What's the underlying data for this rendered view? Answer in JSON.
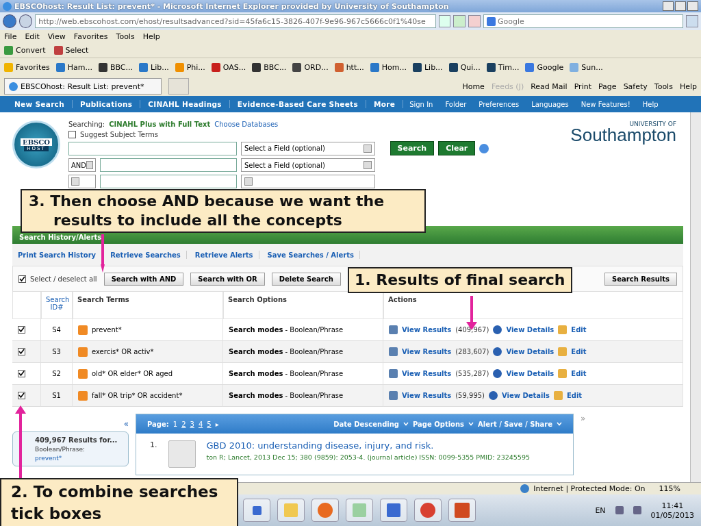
{
  "window": {
    "title": "EBSCOhost: Result List: prevent* - Microsoft Internet Explorer provided by University of Southampton"
  },
  "address_bar": {
    "url": "http://web.ebscohost.com/ehost/resultsadvanced?sid=45fa6c15-3826-407f-9e96-967c5666c0f1%40se",
    "search_placeholder": "Google"
  },
  "menu": [
    "File",
    "Edit",
    "View",
    "Favorites",
    "Tools",
    "Help"
  ],
  "toolbar": [
    "Convert",
    "Select"
  ],
  "favorites": [
    {
      "label": "Favorites",
      "color": "#f0b400"
    },
    {
      "label": "Ham...",
      "color": "#2a78c8"
    },
    {
      "label": "BBC...",
      "color": "#333333"
    },
    {
      "label": "Lib...",
      "color": "#2a78c8"
    },
    {
      "label": "Phi...",
      "color": "#f09000"
    },
    {
      "label": "OAS...",
      "color": "#c8201c"
    },
    {
      "label": "BBC...",
      "color": "#333333"
    },
    {
      "label": "ORD...",
      "color": "#444444"
    },
    {
      "label": "htt...",
      "color": "#d06030"
    },
    {
      "label": "Hom...",
      "color": "#2a78c8"
    },
    {
      "label": "Lib...",
      "color": "#1a4060"
    },
    {
      "label": "Qui...",
      "color": "#1a4060"
    },
    {
      "label": "Tim...",
      "color": "#1a4060"
    },
    {
      "label": "Google",
      "color": "#3a78e0"
    },
    {
      "label": "Sun...",
      "color": "#80b0e0"
    }
  ],
  "tab": {
    "title": "EBSCOhost: Result List: prevent*"
  },
  "command_bar": [
    {
      "label": "Home",
      "disabled": false
    },
    {
      "label": "Feeds (J)",
      "disabled": true
    },
    {
      "label": "Read Mail",
      "disabled": false
    },
    {
      "label": "Print",
      "disabled": false
    },
    {
      "label": "Page",
      "disabled": false
    },
    {
      "label": "Safety",
      "disabled": false
    },
    {
      "label": "Tools",
      "disabled": false
    },
    {
      "label": "Help",
      "disabled": false
    }
  ],
  "site_nav": {
    "main": [
      "New Search",
      "Publications",
      "CINAHL Headings",
      "Evidence-Based Care Sheets",
      "More"
    ],
    "right": [
      "Sign In",
      "Folder",
      "Preferences",
      "Languages",
      "New Features!",
      "Help"
    ]
  },
  "search": {
    "logo": "EBSCO",
    "logo_sub": "HOST",
    "searching_label": "Searching:",
    "database": "CINAHL Plus with Full Text",
    "choose_link": "Choose Databases",
    "suggest": {
      "label": "Suggest Subject Terms",
      "checked": false
    },
    "rows": [
      {
        "operator": null,
        "field": "Select a Field (optional)"
      },
      {
        "operator": "AND",
        "field": "Select a Field (optional)"
      }
    ],
    "buttons": [
      "Search",
      "Clear"
    ],
    "university_small": "UNIVERSITY OF",
    "university": "Southampton"
  },
  "history": {
    "title": "Search History/Alerts",
    "links": [
      "Print Search History",
      "Retrieve Searches",
      "Retrieve Alerts",
      "Save Searches / Alerts"
    ],
    "select_all": {
      "label": "Select / deselect all",
      "checked": true
    },
    "buttons": [
      "Search with AND",
      "Search with OR",
      "Delete Search",
      "Search Results"
    ],
    "columns": [
      "Search ID#",
      "Search Terms",
      "Search Options",
      "Actions"
    ],
    "rows": [
      {
        "checked": true,
        "id": "S4",
        "terms": "prevent*",
        "options": "**Search modes** - Boolean/Phrase",
        "view": "View Results",
        "count": "(409,967)",
        "details": "View Details",
        "edit": "Edit"
      },
      {
        "checked": true,
        "id": "S3",
        "terms": "exercis* OR activ*",
        "options": "**Search modes** - Boolean/Phrase",
        "view": "View Results",
        "count": "(283,607)",
        "details": "View Details",
        "edit": "Edit"
      },
      {
        "checked": true,
        "id": "S2",
        "terms": "old* OR elder* OR aged",
        "options": "**Search modes** - Boolean/Phrase",
        "view": "View Results",
        "count": "(535,287)",
        "details": "View Details",
        "edit": "Edit"
      },
      {
        "checked": true,
        "id": "S1",
        "terms": "fall* OR trip* OR accident*",
        "options": "**Search modes** - Boolean/Phrase",
        "view": "View Results",
        "count": "(59,995)",
        "details": "View Details",
        "edit": "Edit"
      }
    ]
  },
  "results": {
    "left_toggle": "«",
    "right_toggle": "»",
    "summary": "409,967 Results for...",
    "mode": "Boolean/Phrase:",
    "query": "prevent*",
    "page_label": "Page:",
    "pages": [
      "1",
      "2",
      "3",
      "4",
      "5"
    ],
    "next": "▸",
    "menus": [
      "Date Descending",
      "Page Options",
      "Alert / Save / Share"
    ],
    "items": [
      {
        "number": "1.",
        "title": "GBD 2010: understanding disease, injury, and risk.",
        "meta": "ton R; Lancet, 2013 Dec 15; 380 (9859): 2053-4. (journal article) ISSN: 0099-5355 PMID: 23245595"
      }
    ]
  },
  "status_bar": {
    "zone": "Internet | Protected Mode: On",
    "zoom": "115%"
  },
  "taskbar": {
    "language": "EN",
    "time": "11:41",
    "date": "01/05/2013"
  },
  "callouts": [
    {
      "text": "3. Then choose AND because we want the results to include all the concepts"
    },
    {
      "text": "1. Results of final search"
    },
    {
      "text": "2. To combine searches tick boxes"
    }
  ]
}
